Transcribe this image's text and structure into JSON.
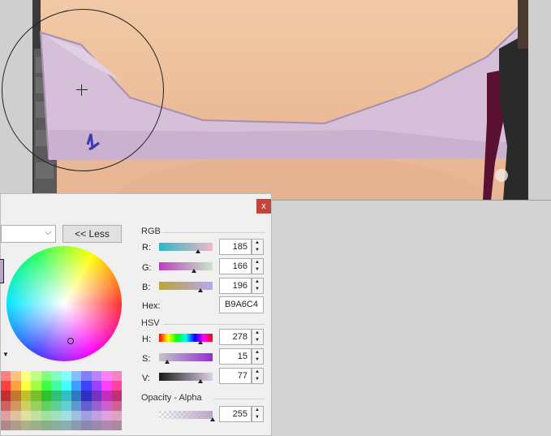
{
  "dialog": {
    "less_button": "<< Less",
    "close_label": "x",
    "current_color": "#B9A6C4",
    "rgb_title": "RGB",
    "hsv_title": "HSV",
    "alpha_title": "Opacity - Alpha",
    "hex_label": "Hex:",
    "hex_value": "B9A6C4",
    "r": {
      "label": "R:",
      "value": "185",
      "fraction": 0.725
    },
    "g": {
      "label": "G:",
      "value": "166",
      "fraction": 0.651
    },
    "b": {
      "label": "B:",
      "value": "196",
      "fraction": 0.769
    },
    "h": {
      "label": "H:",
      "value": "278",
      "fraction": 0.772
    },
    "s": {
      "label": "S:",
      "value": "15",
      "fraction": 0.15
    },
    "v": {
      "label": "V:",
      "value": "77",
      "fraction": 0.77
    },
    "alpha": {
      "value": "255",
      "fraction": 1.0
    }
  },
  "palette_colors": [
    "#ff8080",
    "#ffc080",
    "#ffff80",
    "#c0ff80",
    "#80ff80",
    "#80ffc0",
    "#80ffff",
    "#80c0ff",
    "#8080ff",
    "#c080ff",
    "#ff80ff",
    "#ff80c0",
    "#ff4040",
    "#ffa040",
    "#ffff40",
    "#a0ff40",
    "#40ff40",
    "#40ffa0",
    "#40ffff",
    "#40a0ff",
    "#4040ff",
    "#a040ff",
    "#ff40ff",
    "#ff40a0",
    "#c03030",
    "#c07830",
    "#c0c030",
    "#78c030",
    "#30c030",
    "#30c078",
    "#30c0c0",
    "#3078c0",
    "#3030c0",
    "#7830c0",
    "#c030c0",
    "#c03078",
    "#d06060",
    "#d09860",
    "#d0d060",
    "#98d060",
    "#60d060",
    "#60d098",
    "#60d0d0",
    "#6098d0",
    "#6060d0",
    "#9860d0",
    "#d060d0",
    "#d06098",
    "#e0a0a0",
    "#e0c0a0",
    "#e0e0a0",
    "#c0e0a0",
    "#a0e0a0",
    "#a0e0c0",
    "#a0e0e0",
    "#a0c0e0",
    "#a0a0e0",
    "#c0a0e0",
    "#e0a0e0",
    "#e0a0c0",
    "#b08888",
    "#b09c88",
    "#b0b088",
    "#9cb088",
    "#88b088",
    "#88b09c",
    "#88b0b0",
    "#889cb0",
    "#8888b0",
    "#9c88b0",
    "#b088b0",
    "#b0889c"
  ]
}
